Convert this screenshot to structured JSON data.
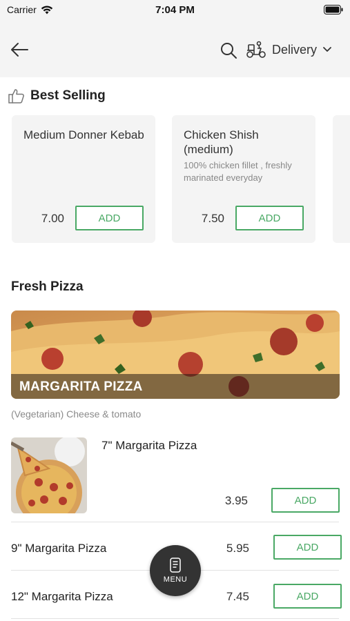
{
  "status_bar": {
    "carrier": "Carrier",
    "time": "7:04 PM"
  },
  "header": {
    "back_icon": "arrow-left-icon",
    "search_icon": "search-icon",
    "delivery_icon": "scooter-icon",
    "delivery_label": "Delivery",
    "dropdown_icon": "chevron-down-icon"
  },
  "best_selling": {
    "title": "Best Selling",
    "icon": "thumbs-up-icon",
    "cards": [
      {
        "name": "Medium Donner Kebab",
        "description": "",
        "price": "7.00",
        "add_label": "ADD"
      },
      {
        "name": "Chicken Shish (medium)",
        "description": "100% chicken fillet , freshly marinated everyday",
        "price": "7.50",
        "add_label": "ADD"
      }
    ]
  },
  "fresh_pizza": {
    "title": "Fresh Pizza",
    "category": {
      "name": "MARGARITA PIZZA",
      "description": "(Vegetarian) Cheese & tomato"
    },
    "items": [
      {
        "name": "7\" Margarita Pizza",
        "price": "3.95",
        "add_label": "ADD"
      },
      {
        "name": "9\" Margarita Pizza",
        "price": "5.95",
        "add_label": "ADD"
      },
      {
        "name": "12\" Margarita Pizza",
        "price": "7.45",
        "add_label": "ADD"
      }
    ]
  },
  "menu_button": {
    "label": "MENU",
    "icon": "menu-card-icon"
  },
  "colors": {
    "accent": "#49a864",
    "header_bg": "#f4f4f4",
    "card_bg": "#f4f4f4",
    "fab_bg": "#333333"
  }
}
